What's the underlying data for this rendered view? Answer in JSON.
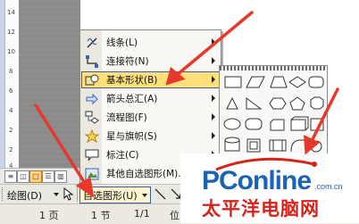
{
  "ruler": {
    "numbers": [
      "14",
      "12",
      "10",
      "8",
      "6",
      "4",
      "2",
      "2",
      "4"
    ]
  },
  "menu": {
    "items": [
      {
        "label": "线条(L)",
        "icon": "line-icon",
        "submenu": true
      },
      {
        "label": "连接符(N)",
        "icon": "connector-icon",
        "submenu": true
      },
      {
        "label": "基本形状(B)",
        "icon": "basic-shapes-icon",
        "submenu": true,
        "selected": true
      },
      {
        "label": "箭头总汇(A)",
        "icon": "arrows-icon",
        "submenu": true
      },
      {
        "label": "流程图(F)",
        "icon": "flowchart-icon",
        "submenu": true
      },
      {
        "label": "星与旗帜(S)",
        "icon": "star-banner-icon",
        "submenu": true
      },
      {
        "label": "标注(C)",
        "icon": "callout-icon",
        "submenu": true
      },
      {
        "label": "其他自选图形(M)...",
        "icon": "more-shapes-icon",
        "submenu": false
      }
    ]
  },
  "drawing_toolbar": {
    "draw_label": "绘图(D)",
    "autoshapes_label": "自选图形(U)"
  },
  "status_bar": {
    "page": "1 页",
    "section": "1 节",
    "page_of": "1/1",
    "position_prefix": "位"
  },
  "watermark": {
    "brand": "PConline",
    "domain": ".com.cn",
    "chinese": "太平洋电脑网"
  },
  "colors": {
    "highlight": "#ffe07a",
    "arrow": "#e8372c",
    "brand_blue": "#1a63b5",
    "brand_red": "#d6241c"
  }
}
